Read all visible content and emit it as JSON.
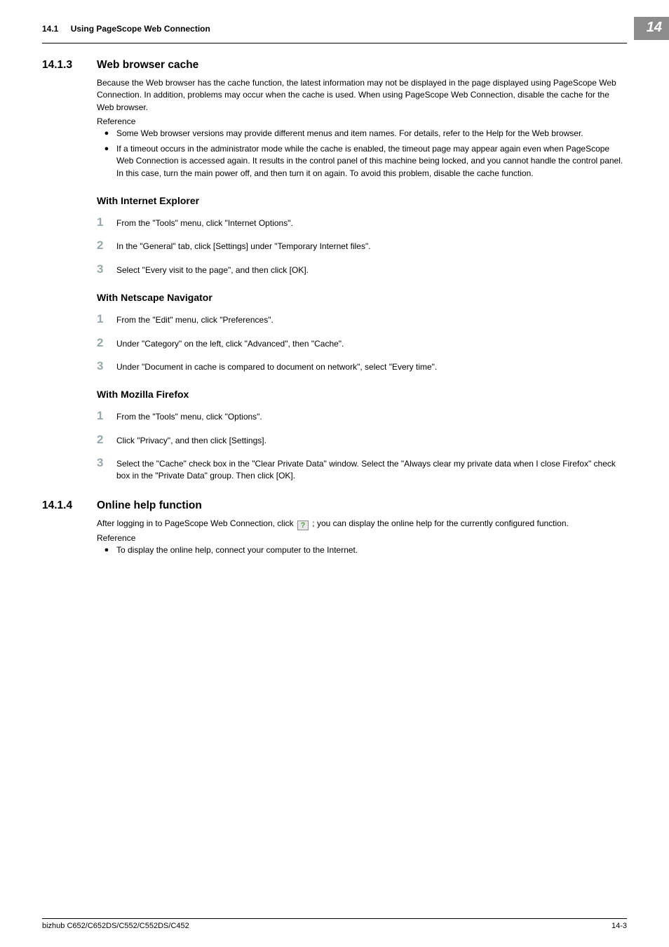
{
  "header": {
    "section_num": "14.1",
    "section_title": "Using PageScope Web Connection",
    "chapter_badge": "14"
  },
  "s1": {
    "num": "14.1.3",
    "title": "Web browser cache",
    "intro": "Because the Web browser has the cache function, the latest information may not be displayed in the page displayed using PageScope Web Connection. In addition, problems may occur when the cache is used. When using PageScope Web Connection, disable the cache for the Web browser.",
    "reference_label": "Reference",
    "bullets": [
      "Some Web browser versions may provide different menus and item names. For details, refer to the Help for the Web browser.",
      "If a timeout occurs in the administrator mode while the cache is enabled, the timeout page may appear again even when PageScope Web Connection is accessed again. It results in the control panel of this machine being locked, and you cannot handle the control panel. In this case, turn the main power off, and then turn it on again. To avoid this problem, disable the cache function."
    ],
    "ie": {
      "title": "With Internet Explorer",
      "steps": [
        "From the \"Tools\" menu, click \"Internet Options\".",
        "In the \"General\" tab, click [Settings] under \"Temporary Internet files\".",
        "Select \"Every visit to the page\", and then click [OK]."
      ]
    },
    "nn": {
      "title": "With Netscape Navigator",
      "steps": [
        "From the \"Edit\" menu, click \"Preferences\".",
        "Under \"Category\" on the left, click \"Advanced\", then \"Cache\".",
        "Under \"Document in cache is compared to document on network\", select \"Every time\"."
      ]
    },
    "ff": {
      "title": "With Mozilla Firefox",
      "steps": [
        "From the \"Tools\" menu, click \"Options\".",
        "Click \"Privacy\", and then click [Settings].",
        "Select the \"Cache\" check box in the \"Clear Private Data\" window. Select the \"Always clear my private data when I close Firefox\" check box in the \"Private Data\" group. Then click [OK]."
      ]
    }
  },
  "s2": {
    "num": "14.1.4",
    "title": "Online help function",
    "para_before": "After logging in to PageScope Web Connection, click ",
    "para_after": " ; you can display the online help for the currently configured function.",
    "reference_label": "Reference",
    "bullets": [
      "To display the online help, connect your computer to the Internet."
    ]
  },
  "footer": {
    "model": "bizhub C652/C652DS/C552/C552DS/C452",
    "page": "14-3"
  }
}
